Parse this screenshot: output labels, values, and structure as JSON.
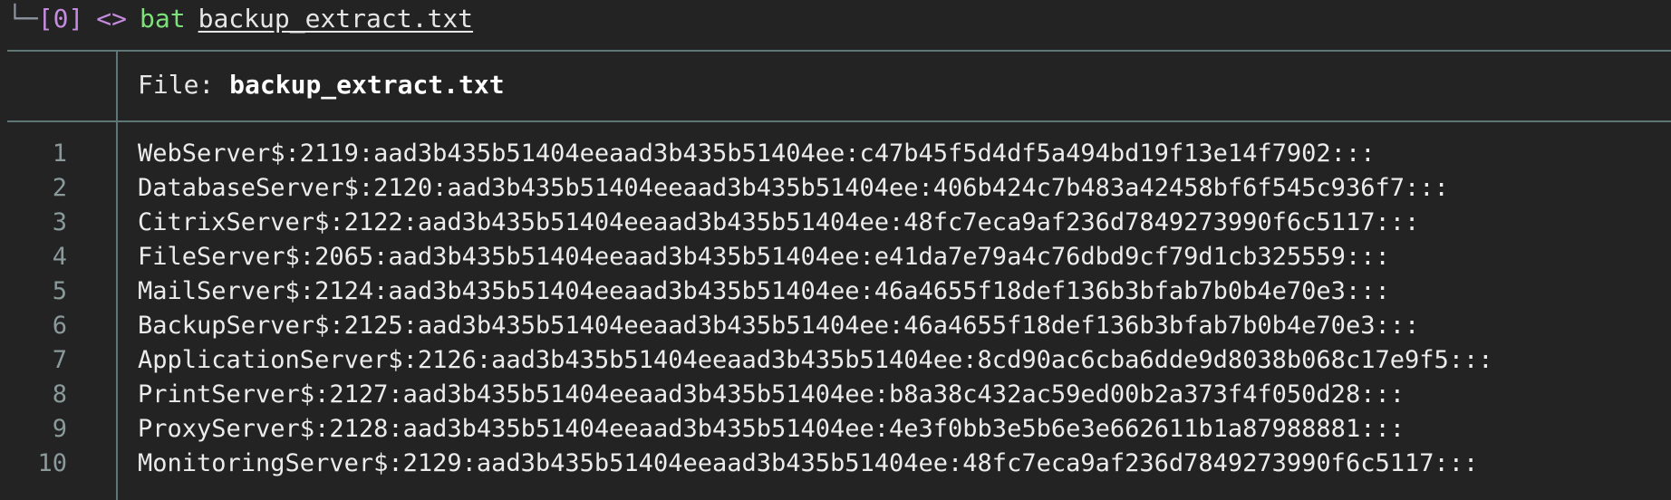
{
  "prompt": {
    "corner": "└─",
    "index": "[0]",
    "symbol": "<>",
    "command": "bat",
    "argument": "backup_extract.txt"
  },
  "file_header": {
    "label": "File: ",
    "name": "backup_extract.txt"
  },
  "lines": [
    {
      "n": "1",
      "text": "WebServer$:2119:aad3b435b51404eeaad3b435b51404ee:c47b45f5d4df5a494bd19f13e14f7902:::"
    },
    {
      "n": "2",
      "text": "DatabaseServer$:2120:aad3b435b51404eeaad3b435b51404ee:406b424c7b483a42458bf6f545c936f7:::"
    },
    {
      "n": "3",
      "text": "CitrixServer$:2122:aad3b435b51404eeaad3b435b51404ee:48fc7eca9af236d7849273990f6c5117:::"
    },
    {
      "n": "4",
      "text": "FileServer$:2065:aad3b435b51404eeaad3b435b51404ee:e41da7e79a4c76dbd9cf79d1cb325559:::"
    },
    {
      "n": "5",
      "text": "MailServer$:2124:aad3b435b51404eeaad3b435b51404ee:46a4655f18def136b3bfab7b0b4e70e3:::"
    },
    {
      "n": "6",
      "text": "BackupServer$:2125:aad3b435b51404eeaad3b435b51404ee:46a4655f18def136b3bfab7b0b4e70e3:::"
    },
    {
      "n": "7",
      "text": "ApplicationServer$:2126:aad3b435b51404eeaad3b435b51404ee:8cd90ac6cba6dde9d8038b068c17e9f5:::"
    },
    {
      "n": "8",
      "text": "PrintServer$:2127:aad3b435b51404eeaad3b435b51404ee:b8a38c432ac59ed00b2a373f4f050d28:::"
    },
    {
      "n": "9",
      "text": "ProxyServer$:2128:aad3b435b51404eeaad3b435b51404ee:4e3f0bb3e5b6e3e662611b1a87988881:::"
    },
    {
      "n": "10",
      "text": "MonitoringServer$:2129:aad3b435b51404eeaad3b435b51404ee:48fc7eca9af236d7849273990f6c5117:::"
    }
  ]
}
